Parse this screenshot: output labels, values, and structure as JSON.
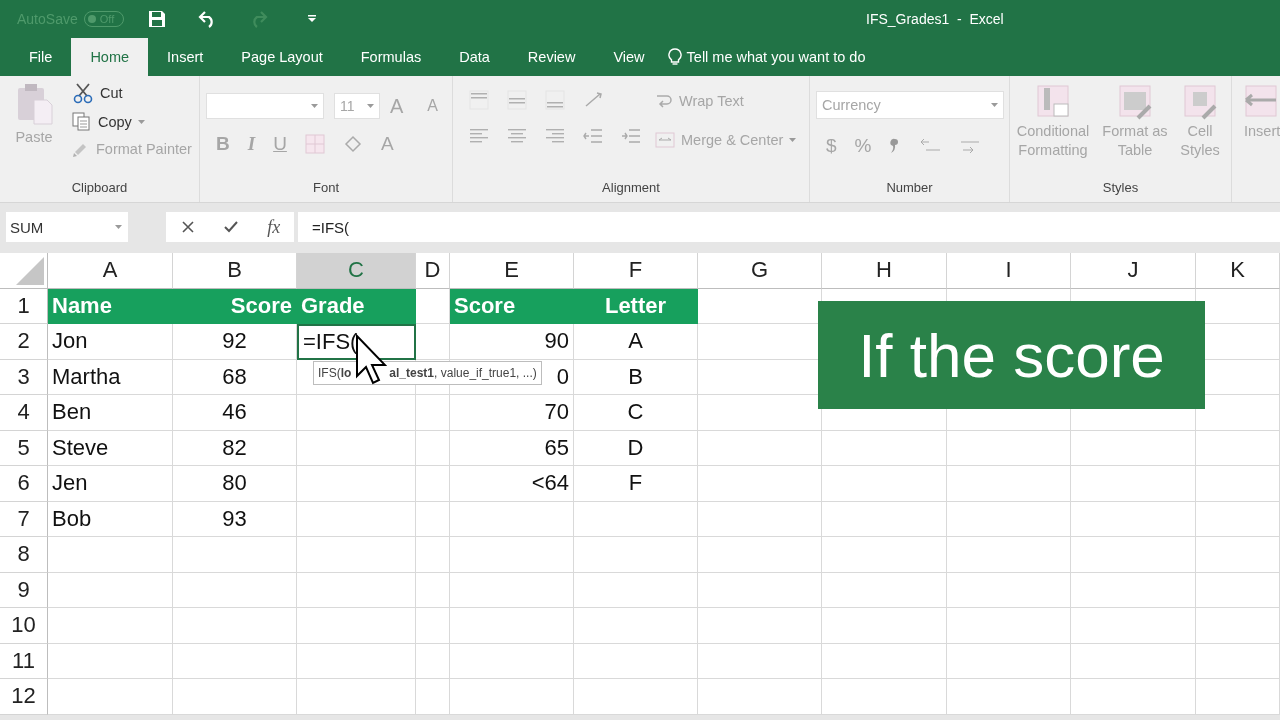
{
  "title_bar": {
    "autosave": "AutoSave",
    "autosave_toggle": "Off",
    "title": "IFS_Grades1  -  Excel"
  },
  "tabs": [
    {
      "label": "File",
      "selected": false
    },
    {
      "label": "Home",
      "selected": true
    },
    {
      "label": "Insert",
      "selected": false
    },
    {
      "label": "Page Layout",
      "selected": false
    },
    {
      "label": "Formulas",
      "selected": false
    },
    {
      "label": "Data",
      "selected": false
    },
    {
      "label": "Review",
      "selected": false
    },
    {
      "label": "View",
      "selected": false
    }
  ],
  "tell_me": "Tell me what you want to do",
  "ribbon": {
    "clipboard": {
      "paste": "Paste",
      "cut": "Cut",
      "copy": "Copy",
      "format_painter": "Format Painter",
      "label": "Clipboard"
    },
    "font": {
      "size": "11",
      "grow": "A",
      "shrink": "A",
      "bold": "B",
      "italic": "I",
      "underline": "U",
      "font_color": "A",
      "label": "Font"
    },
    "alignment": {
      "wrap_text": "Wrap Text",
      "merge_center": "Merge & Center",
      "label": "Alignment"
    },
    "number": {
      "format": "Currency",
      "currency": "$",
      "percent": "%",
      "label": "Number"
    },
    "styles": {
      "conditional": "Conditional Formatting",
      "format_table": "Format as Table",
      "cell_styles": "Cell Styles",
      "label": "Styles"
    },
    "cells": {
      "insert": "Insert"
    }
  },
  "formula_bar": {
    "name_box": "SUM",
    "fx": "fx",
    "formula": "=IFS("
  },
  "columns": [
    {
      "label": "A",
      "selected": false
    },
    {
      "label": "B",
      "selected": false
    },
    {
      "label": "C",
      "selected": true
    },
    {
      "label": "D",
      "selected": false
    },
    {
      "label": "E",
      "selected": false
    },
    {
      "label": "F",
      "selected": false
    },
    {
      "label": "G",
      "selected": false
    },
    {
      "label": "H",
      "selected": false
    },
    {
      "label": "I",
      "selected": false
    },
    {
      "label": "J",
      "selected": false
    },
    {
      "label": "K",
      "selected": false
    }
  ],
  "rows": [
    {
      "number": "1",
      "cells": [
        {
          "text": "Name",
          "kind": "header"
        },
        {
          "text": "Score",
          "kind": "header"
        },
        {
          "text": "Grade",
          "kind": "header"
        },
        null,
        {
          "text": "Score",
          "kind": "header"
        },
        {
          "text": "Letter",
          "kind": "header"
        }
      ]
    },
    {
      "number": "2",
      "cells": [
        {
          "text": "Jon",
          "kind": "value"
        },
        {
          "text": "92",
          "kind": "value"
        },
        {
          "text": "=IFS(",
          "kind": "editing"
        },
        null,
        {
          "text": "90",
          "kind": "value"
        },
        {
          "text": "A",
          "kind": "value"
        }
      ]
    },
    {
      "number": "3",
      "cells": [
        {
          "text": "Martha",
          "kind": "value"
        },
        {
          "text": "68",
          "kind": "value"
        },
        null,
        null,
        {
          "text": "0",
          "kind": "value"
        },
        {
          "text": "B",
          "kind": "value"
        }
      ]
    },
    {
      "number": "4",
      "cells": [
        {
          "text": "Ben",
          "kind": "value"
        },
        {
          "text": "46",
          "kind": "value"
        },
        null,
        null,
        {
          "text": "70",
          "kind": "value"
        },
        {
          "text": "C",
          "kind": "value"
        }
      ]
    },
    {
      "number": "5",
      "cells": [
        {
          "text": "Steve",
          "kind": "value"
        },
        {
          "text": "82",
          "kind": "value"
        },
        null,
        null,
        {
          "text": "65",
          "kind": "value"
        },
        {
          "text": "D",
          "kind": "value"
        }
      ]
    },
    {
      "number": "6",
      "cells": [
        {
          "text": "Jen",
          "kind": "value"
        },
        {
          "text": "80",
          "kind": "value"
        },
        null,
        null,
        {
          "text": "<64",
          "kind": "value"
        },
        {
          "text": "F",
          "kind": "value"
        }
      ]
    },
    {
      "number": "7",
      "cells": [
        {
          "text": "Bob",
          "kind": "value"
        },
        {
          "text": "93",
          "kind": "value"
        }
      ]
    },
    {
      "number": "8"
    },
    {
      "number": "9"
    },
    {
      "number": "10"
    },
    {
      "number": "11"
    },
    {
      "number": "12"
    }
  ],
  "tooltip": [
    "IFS(**lo**",
    "**al_test1**, value_if_true1, ...)"
  ],
  "callout": "If the score"
}
